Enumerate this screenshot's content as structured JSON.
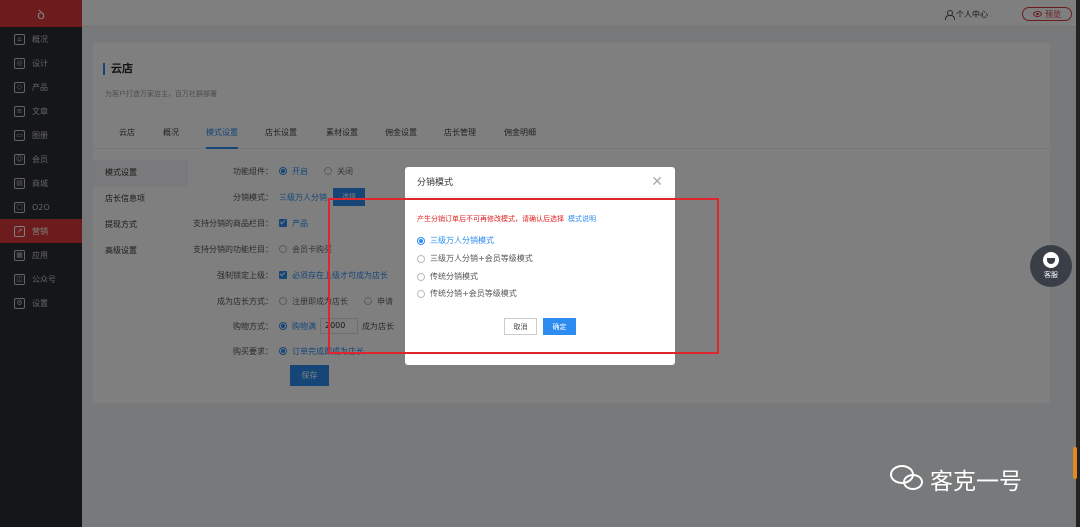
{
  "app": {
    "logo": "ꝺ"
  },
  "sidebar": {
    "items": [
      {
        "label": "概况",
        "icon": "overview-icon",
        "glyph": "⌂"
      },
      {
        "label": "设计",
        "icon": "design-icon",
        "glyph": "◎"
      },
      {
        "label": "产品",
        "icon": "product-icon",
        "glyph": "◇"
      },
      {
        "label": "文章",
        "icon": "article-icon",
        "glyph": "≡"
      },
      {
        "label": "图册",
        "icon": "album-icon",
        "glyph": "▭"
      },
      {
        "label": "会员",
        "icon": "member-icon",
        "glyph": "☺"
      },
      {
        "label": "商城",
        "icon": "mall-icon",
        "glyph": "▤"
      },
      {
        "label": "O2O",
        "icon": "o2o-icon",
        "glyph": "▢"
      },
      {
        "label": "营销",
        "icon": "marketing-icon",
        "glyph": "↗"
      },
      {
        "label": "应用",
        "icon": "apps-icon",
        "glyph": "▦"
      },
      {
        "label": "公众号",
        "icon": "official-account-icon",
        "glyph": "◫"
      },
      {
        "label": "设置",
        "icon": "settings-icon",
        "glyph": "⚙"
      }
    ],
    "active_index": 8
  },
  "topbar": {
    "user_center": "个人中心",
    "preview": "预览"
  },
  "page": {
    "title": "云店",
    "subtitle": "为客户打造万家店主，百万社群部署",
    "tabs": [
      "云店",
      "概况",
      "模式设置",
      "店长设置",
      "素材设置",
      "佣金设置",
      "店长管理",
      "佣金明细"
    ],
    "active_tab": 2,
    "side_menu": [
      "模式设置",
      "店长信息项",
      "提现方式",
      "高级设置"
    ],
    "form": {
      "feature_label": "功能组件：",
      "feature_on": "开启",
      "feature_off": "关闭",
      "mode_label": "分销模式：",
      "mode_value": "三级万人分销",
      "mode_button": "选择",
      "goods_label": "支持分销的商品栏目：",
      "goods_value": "产品",
      "feature_col_label": "支持分销的功能栏目：",
      "feature_col_value": "会员卡购买",
      "bind_label": "强制锁定上级：",
      "bind_value": "必须存在上级才可成为店长",
      "become_label": "成为店长方式：",
      "become_opt1": "注册即成为店长",
      "become_opt2": "申请",
      "buy_label": "购物方式：",
      "buy_opt": "购物满",
      "buy_amount": "2000",
      "buy_suffix": "成为店长",
      "require_label": "购买要求：",
      "require_value": "订单完成即成为店长",
      "save": "保存"
    }
  },
  "modal": {
    "title": "分销模式",
    "warning": "产生分销订单后不可再修改模式，请确认后选择",
    "help_link": "模式说明",
    "options": [
      "三级万人分销模式",
      "三级万人分销+会员等级模式",
      "传统分销模式",
      "传统分销+会员等级模式"
    ],
    "selected": 0,
    "cancel": "取消",
    "confirm": "确定"
  },
  "float": {
    "service": "客服"
  },
  "watermark": {
    "text": "客克一号"
  },
  "colors": {
    "brand_red": "#d9383a",
    "primary_blue": "#2d8cf0",
    "sidebar_bg": "#2b2c30"
  }
}
